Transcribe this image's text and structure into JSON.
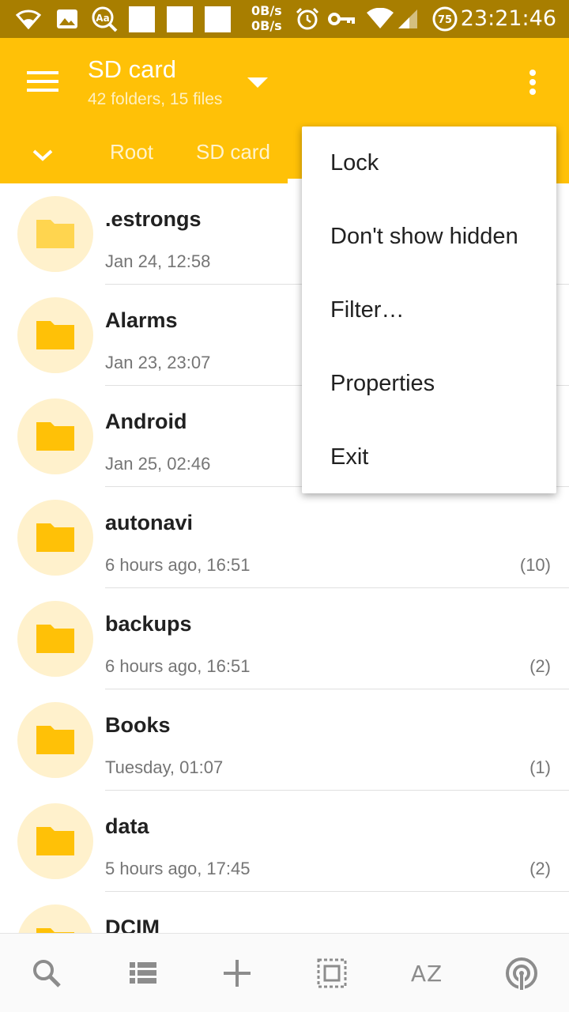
{
  "status_bar": {
    "speed_up": "0B/s",
    "speed_down": "0B/s",
    "battery": "75",
    "time": "23:21:46",
    "icons": [
      "wifi-icon",
      "image-icon",
      "font-search-icon",
      "alarm-icon",
      "vpn-key-icon",
      "wifi-signal-icon",
      "cell-signal-icon",
      "battery-icon"
    ]
  },
  "app_bar": {
    "title": "SD card",
    "subtitle": "42 folders, 15 files",
    "breadcrumbs": [
      "Root",
      "SD card"
    ],
    "accent_color": "#FFC107"
  },
  "files": [
    {
      "name": ".estrongs",
      "date": "Jan 24, 12:58",
      "count": "",
      "hidden": true
    },
    {
      "name": "Alarms",
      "date": "Jan 23, 23:07",
      "count": ""
    },
    {
      "name": "Android",
      "date": "Jan 25, 02:46",
      "count": ""
    },
    {
      "name": "autonavi",
      "date": "6 hours ago, 16:51",
      "count": "(10)"
    },
    {
      "name": "backups",
      "date": "6 hours ago, 16:51",
      "count": "(2)"
    },
    {
      "name": "Books",
      "date": "Tuesday, 01:07",
      "count": "(1)"
    },
    {
      "name": "data",
      "date": "5 hours ago, 17:45",
      "count": "(2)"
    },
    {
      "name": "DCIM",
      "date": "",
      "count": ""
    }
  ],
  "overflow_menu": {
    "items": [
      "Lock",
      "Don't show hidden",
      "Filter…",
      "Properties",
      "Exit"
    ]
  },
  "bottom_bar": {
    "sort_label": "AZ",
    "icons": [
      "search-icon",
      "list-view-icon",
      "add-icon",
      "select-all-icon",
      "sort-icon",
      "wifi-share-icon"
    ]
  }
}
